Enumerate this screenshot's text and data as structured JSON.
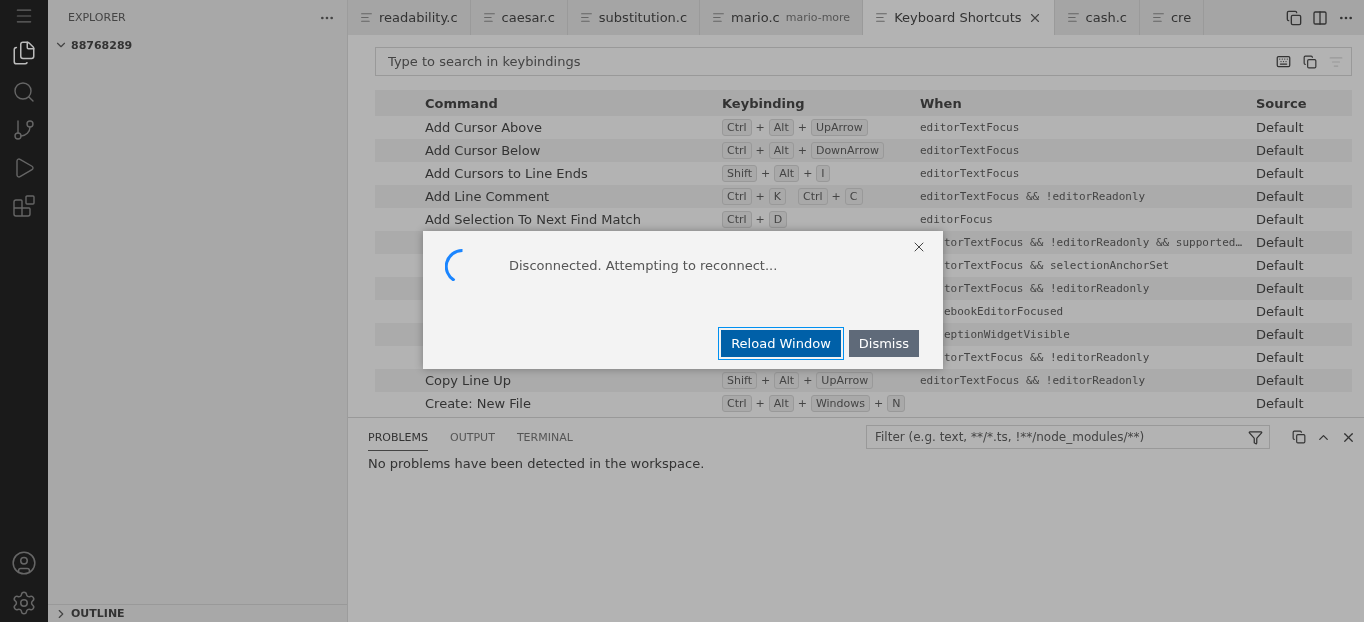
{
  "sidebar": {
    "title": "EXPLORER",
    "folder": {
      "label": "88768289",
      "expanded": true
    },
    "outline": {
      "label": "OUTLINE",
      "expanded": false
    }
  },
  "tabs": [
    {
      "label": "readability.c",
      "selected": false
    },
    {
      "label": "caesar.c",
      "selected": false
    },
    {
      "label": "substitution.c",
      "selected": false
    },
    {
      "label": "mario.c",
      "description": "mario-more",
      "selected": false
    },
    {
      "label": "Keyboard Shortcuts",
      "selected": true
    },
    {
      "label": "cash.c",
      "selected": false
    },
    {
      "label": "cre",
      "selected": false
    }
  ],
  "search": {
    "placeholder": "Type to search in keybindings"
  },
  "table": {
    "columns": [
      "Command",
      "Keybinding",
      "When",
      "Source"
    ],
    "rows": [
      {
        "command": "Add Cursor Above",
        "keys": [
          [
            "Ctrl",
            "+",
            "Alt",
            "+",
            "UpArrow"
          ]
        ],
        "when": "editorTextFocus",
        "source": "Default"
      },
      {
        "command": "Add Cursor Below",
        "keys": [
          [
            "Ctrl",
            "+",
            "Alt",
            "+",
            "DownArrow"
          ]
        ],
        "when": "editorTextFocus",
        "source": "Default"
      },
      {
        "command": "Add Cursors to Line Ends",
        "keys": [
          [
            "Shift",
            "+",
            "Alt",
            "+",
            "I"
          ]
        ],
        "when": "editorTextFocus",
        "source": "Default"
      },
      {
        "command": "Add Line Comment",
        "keys": [
          [
            "Ctrl",
            "+",
            "K"
          ],
          [
            "Ctrl",
            "+",
            "C"
          ]
        ],
        "when": "editorTextFocus && !editorReadonly",
        "source": "Default"
      },
      {
        "command": "Add Selection To Next Find Match",
        "keys": [
          [
            "Ctrl",
            "+",
            "D"
          ]
        ],
        "when": "editorFocus",
        "source": "Default"
      },
      {
        "when": "torTextFocus && !editorReadonly && supported…",
        "source": "Default"
      },
      {
        "when": "torTextFocus && selectionAnchorSet",
        "source": "Default"
      },
      {
        "when": "torTextFocus && !editorReadonly",
        "source": "Default"
      },
      {
        "when": "ebookEditorFocused",
        "source": "Default"
      },
      {
        "when": "eptionWidgetVisible",
        "source": "Default"
      },
      {
        "when": "torTextFocus && !editorReadonly",
        "source": "Default"
      },
      {
        "command": "Copy Line Up",
        "keys": [
          [
            "Shift",
            "+",
            "Alt",
            "+",
            "UpArrow"
          ]
        ],
        "when": "editorTextFocus && !editorReadonly",
        "source": "Default"
      },
      {
        "command": "Create: New File",
        "keys": [
          [
            "Ctrl",
            "+",
            "Alt",
            "+",
            "Windows",
            "+",
            "N"
          ]
        ],
        "source": "Default"
      }
    ]
  },
  "dialog": {
    "message": "Disconnected. Attempting to reconnect...",
    "buttons": [
      {
        "label": "Reload Window",
        "kind": "primary"
      },
      {
        "label": "Dismiss",
        "kind": "secondary"
      }
    ]
  },
  "panel": {
    "tabs": [
      {
        "label": "PROBLEMS",
        "selected": true
      },
      {
        "label": "OUTPUT",
        "selected": false
      },
      {
        "label": "TERMINAL",
        "selected": false
      }
    ],
    "filter": {
      "placeholder": "Filter (e.g. text, **/*.ts, !**/node_modules/**)"
    },
    "message": "No problems have been detected in the workspace."
  }
}
